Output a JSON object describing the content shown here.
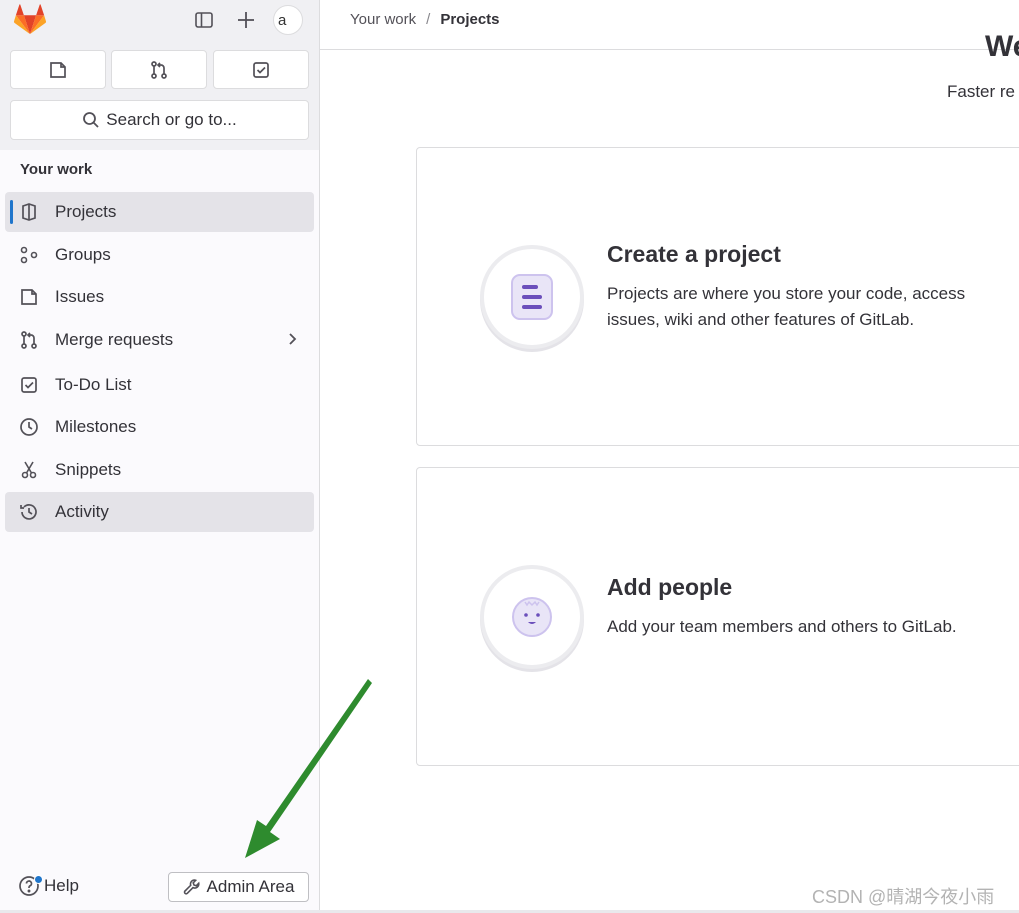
{
  "header": {
    "avatar_alt": "a",
    "breadcrumb": {
      "parent": "Your work",
      "separator": "/",
      "current": "Projects"
    }
  },
  "sidebar": {
    "search_placeholder": "Search or go to...",
    "section_label": "Your work",
    "items": [
      {
        "label": "Projects",
        "icon": "project-icon",
        "active": true
      },
      {
        "label": "Groups",
        "icon": "group-icon"
      },
      {
        "label": "Issues",
        "icon": "issues-icon"
      },
      {
        "label": "Merge requests",
        "icon": "merge-request-icon",
        "has_submenu": true
      },
      {
        "label": "To-Do List",
        "icon": "todo-icon"
      },
      {
        "label": "Milestones",
        "icon": "milestone-icon"
      },
      {
        "label": "Snippets",
        "icon": "snippet-icon"
      },
      {
        "label": "Activity",
        "icon": "history-icon",
        "hovered": true
      }
    ],
    "help_label": "Help",
    "admin_label": "Admin Area"
  },
  "main": {
    "welcome_title": "We",
    "welcome_subtitle": "Faster re",
    "cards": [
      {
        "title": "Create a project",
        "description": "Projects are where you store your code, access issues, wiki and other features of GitLab."
      },
      {
        "title": "Add people",
        "description": "Add your team members and others to GitLab."
      }
    ]
  },
  "watermark": "CSDN @晴湖今夜小雨",
  "colors": {
    "accent": "#1f75cb",
    "arrow": "#2e8b2e",
    "illustration": "#6b4fbb"
  }
}
